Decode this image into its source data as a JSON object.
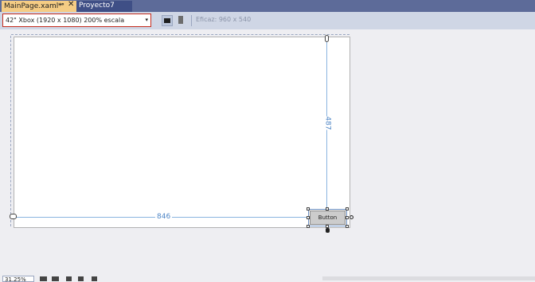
{
  "tabs": {
    "active": {
      "label": "MainPage.xaml*",
      "pin": "⊸",
      "close": "✕"
    },
    "project": {
      "label": "Proyecto7"
    }
  },
  "toolbar": {
    "device": "42\" Xbox (1920 x 1080) 200% escala",
    "device_arrow": "▾",
    "effective": "Eficaz: 960 x 540"
  },
  "design": {
    "height_label": "487",
    "width_label": "846",
    "button_label": "Button"
  },
  "status": {
    "zoom": "31,25%"
  },
  "colors": {
    "tab_active": "#f5cc84",
    "tab_strip": "#5d6b99",
    "toolbar": "#cfd6e5",
    "dimension_line": "#8ab4e0",
    "dimension_text": "#4f86c6",
    "highlight_border": "#c42b1c"
  }
}
